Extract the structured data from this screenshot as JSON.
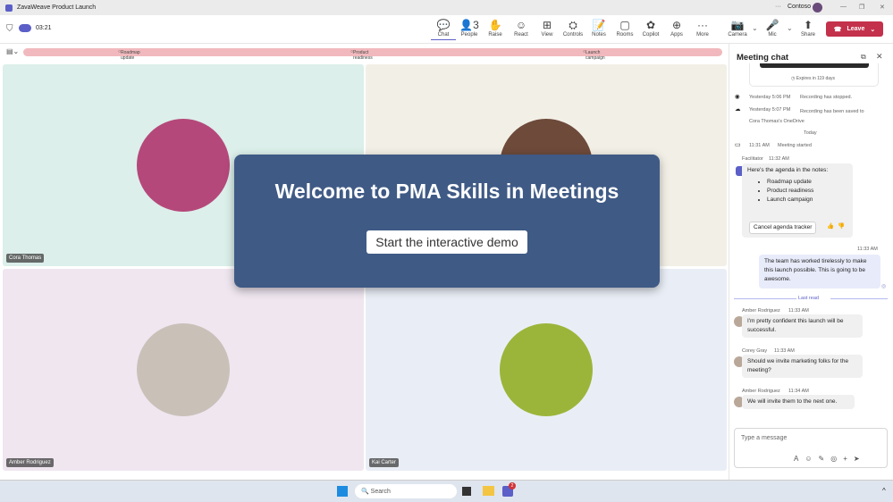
{
  "window": {
    "title": "ZavaWeave Product Launch",
    "org": "Contoso",
    "more": "···",
    "minimize": "—",
    "maximize": "❐",
    "close": "✕"
  },
  "meeting": {
    "timer": "03:21"
  },
  "toolbar": [
    {
      "label": "Chat",
      "icon": "chat-icon",
      "glyph": "💬"
    },
    {
      "label": "People",
      "icon": "people-icon",
      "glyph": "👤",
      "count": "3"
    },
    {
      "label": "Raise",
      "icon": "hand-icon",
      "glyph": "✋"
    },
    {
      "label": "React",
      "icon": "smile-icon",
      "glyph": "☺"
    },
    {
      "label": "View",
      "icon": "grid-icon",
      "glyph": "⊞"
    },
    {
      "label": "Controls",
      "icon": "controls-icon",
      "glyph": "⛭"
    },
    {
      "label": "Notes",
      "icon": "notes-icon",
      "glyph": "📝"
    },
    {
      "label": "Rooms",
      "icon": "rooms-icon",
      "glyph": "▢"
    },
    {
      "label": "Copilot",
      "icon": "copilot-icon",
      "glyph": "✿"
    },
    {
      "label": "Apps",
      "icon": "apps-icon",
      "glyph": "⊕"
    },
    {
      "label": "More",
      "icon": "more-icon",
      "glyph": "···"
    },
    {
      "label": "Camera",
      "icon": "camera-off-icon",
      "glyph": "📷"
    },
    {
      "label": "Mic",
      "icon": "mic-icon",
      "glyph": "🎤"
    },
    {
      "label": "Share",
      "icon": "share-icon",
      "glyph": "⬆"
    }
  ],
  "leave": {
    "label": "Leave"
  },
  "agenda": [
    "Roadmap update",
    "Product readiness",
    "Launch campaign"
  ],
  "participants": [
    {
      "name": "Cora Thomas",
      "color": "#b5487a",
      "bg": "#dcefea"
    },
    {
      "name": "",
      "color": "#6d4a3a",
      "bg": "#f2efe6"
    },
    {
      "name": "Amber Rodriguez",
      "color": "#c9c1b8",
      "bg": "#efe6f0"
    },
    {
      "name": "Kai Carter",
      "color": "#9bb53a",
      "bg": "#e9eef6"
    }
  ],
  "modal": {
    "title": "Welcome to PMA Skills in Meetings",
    "button": "Start the interactive demo"
  },
  "chat": {
    "title": "Meeting chat",
    "expires": "Expires in 119 days",
    "events": [
      {
        "time": "Yesterday 5:06 PM",
        "text": "Recording has stopped."
      },
      {
        "time": "Yesterday 5:07 PM",
        "text": "Recording has been saved to Cora Thomas's OneDrive"
      }
    ],
    "today": "Today",
    "meeting_started": {
      "time": "11:31 AM",
      "text": "Meeting started"
    },
    "facilitator": {
      "name": "Facilitator",
      "time": "11:32 AM",
      "text": "Here's the agenda in the notes:",
      "items": [
        "Roadmap update",
        "Product readiness",
        "Launch campaign"
      ],
      "button": "Cancel agenda tracker"
    },
    "self": {
      "time": "11:33 AM",
      "text": "The team has worked tirelessly to make this launch possible. This is going to be awesome."
    },
    "last_read": "Last read",
    "messages": [
      {
        "name": "Amber Rodriguez",
        "time": "11:33 AM",
        "text": "I'm pretty confident this launch will be successful."
      },
      {
        "name": "Corey Gray",
        "time": "11:33 AM",
        "text": "Should we invite marketing folks for the meeting?"
      },
      {
        "name": "Amber Rodriguez",
        "time": "11:34 AM",
        "text": "We will invite them to the next one."
      }
    ],
    "input_placeholder": "Type a message"
  },
  "taskbar": {
    "search": "Search",
    "badge": "2"
  }
}
